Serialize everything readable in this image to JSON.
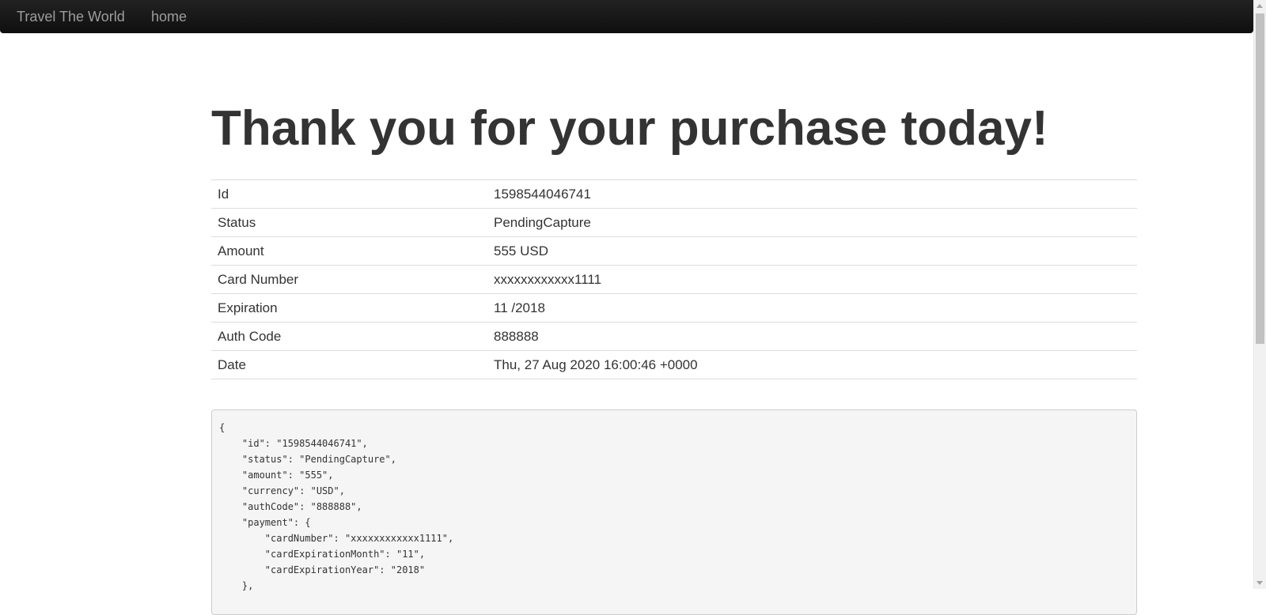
{
  "navbar": {
    "brand": "Travel The World",
    "links": [
      "home"
    ]
  },
  "page": {
    "title": "Thank you for your purchase today!"
  },
  "details": {
    "rows": [
      {
        "label": "Id",
        "value": "1598544046741"
      },
      {
        "label": "Status",
        "value": "PendingCapture"
      },
      {
        "label": "Amount",
        "value": "555 USD"
      },
      {
        "label": "Card Number",
        "value": "xxxxxxxxxxxx1111"
      },
      {
        "label": "Expiration",
        "value": "11 /2018"
      },
      {
        "label": "Auth Code",
        "value": "888888"
      },
      {
        "label": "Date",
        "value": "Thu, 27 Aug 2020 16:00:46 +0000"
      }
    ]
  },
  "response_json": {
    "lines": [
      "{",
      "    \"id\": \"1598544046741\",",
      "    \"status\": \"PendingCapture\",",
      "    \"amount\": \"555\",",
      "    \"currency\": \"USD\",",
      "    \"authCode\": \"888888\",",
      "    \"payment\": {",
      "        \"cardNumber\": \"xxxxxxxxxxxx1111\",",
      "        \"cardExpirationMonth\": \"11\",",
      "        \"cardExpirationYear\": \"2018\"",
      "    },"
    ]
  }
}
